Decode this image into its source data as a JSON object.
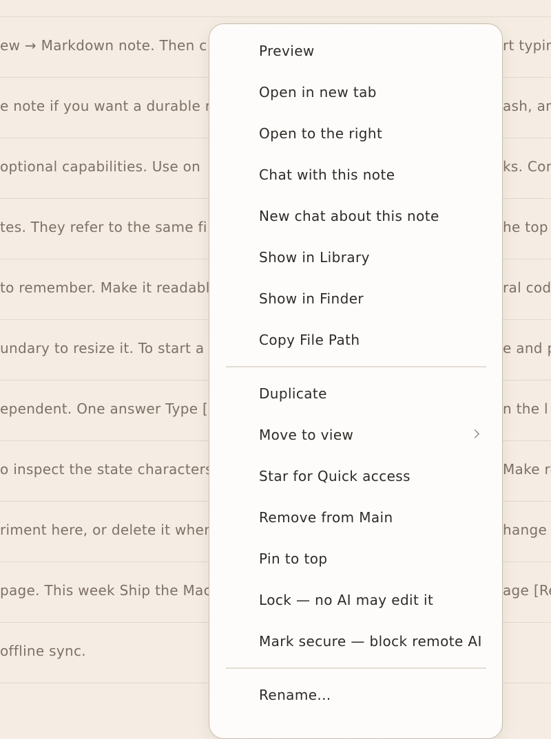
{
  "background_rows": [
    {
      "left": "ew → Markdown note. Then c",
      "right": "rt typing"
    },
    {
      "left": "e note if you want a durable r",
      "right": "ash, an"
    },
    {
      "left": " optional capabilities. Use on",
      "right": "ks. Con"
    },
    {
      "left": "tes. They refer to the same fi",
      "right": "he top"
    },
    {
      "left": "to remember. Make it readabl",
      "right": "ral cod"
    },
    {
      "left": "undary to resize it. To start a",
      "right": "e and p"
    },
    {
      "left": "ependent. One answer Type [#",
      "right": "n the l"
    },
    {
      "left": "o inspect the state characters",
      "right": "Make ro"
    },
    {
      "left": "riment here, or delete it when",
      "right": "hange t"
    },
    {
      "left": "page. This week Ship the Mac",
      "right": "age [Re"
    },
    {
      "left": "offline sync.",
      "right": ""
    }
  ],
  "context_menu": {
    "items": [
      {
        "label": "Preview"
      },
      {
        "label": "Open in new tab"
      },
      {
        "label": "Open to the right"
      },
      {
        "label": "Chat with this note"
      },
      {
        "label": "New chat about this note"
      },
      {
        "label": "Show in Library"
      },
      {
        "label": "Show in Finder"
      },
      {
        "label": "Copy File Path"
      },
      {
        "label": "Duplicate"
      },
      {
        "label": "Move to view",
        "icon": "chevron-right-icon"
      },
      {
        "label": "Star for Quick access"
      },
      {
        "label": "Remove from Main"
      },
      {
        "label": "Pin to top"
      },
      {
        "label": "Lock — no AI may edit it"
      },
      {
        "label": "Mark secure — block remote AI"
      },
      {
        "label": "Rename..."
      }
    ]
  }
}
